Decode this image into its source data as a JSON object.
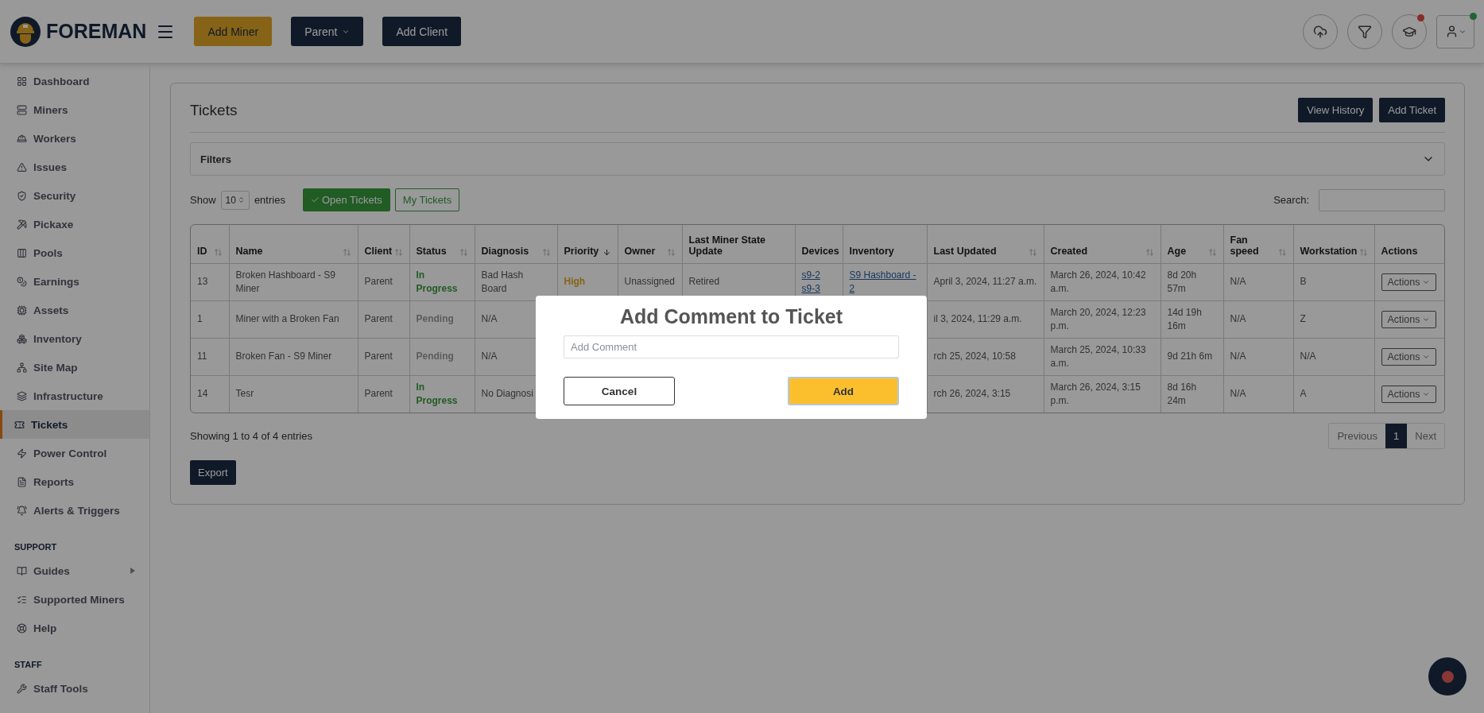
{
  "header": {
    "logo": "FOREMAN",
    "buttons": [
      {
        "label": "Add Miner",
        "kind": "gold"
      },
      {
        "label": "Parent",
        "kind": "dropdown"
      },
      {
        "label": "Add Client",
        "kind": "dark"
      }
    ],
    "notification_dot": true,
    "user_online": true
  },
  "sidebar": {
    "sections": [
      {
        "items": [
          {
            "label": "Dashboard",
            "selected": false
          },
          {
            "label": "Miners",
            "selected": false
          },
          {
            "label": "Workers",
            "selected": false
          },
          {
            "label": "Issues",
            "selected": false
          },
          {
            "label": "Security",
            "selected": false
          },
          {
            "label": "Pickaxe",
            "selected": false
          },
          {
            "label": "Pools",
            "selected": false
          },
          {
            "label": "Earnings",
            "selected": false
          },
          {
            "label": "Assets",
            "selected": false
          },
          {
            "label": "Inventory",
            "selected": false
          },
          {
            "label": "Site Map",
            "selected": false
          },
          {
            "label": "Infrastructure",
            "selected": false
          },
          {
            "label": "Tickets",
            "selected": true
          },
          {
            "label": "Power Control",
            "selected": false
          },
          {
            "label": "Reports",
            "selected": false
          },
          {
            "label": "Alerts & Triggers",
            "selected": false
          }
        ]
      },
      {
        "heading": "SUPPORT",
        "items": [
          {
            "label": "Guides",
            "selected": false,
            "submenu": true
          },
          {
            "label": "Supported Miners",
            "selected": false
          },
          {
            "label": "Help",
            "selected": false
          }
        ]
      },
      {
        "heading": "STAFF",
        "items": [
          {
            "label": "Staff Tools",
            "selected": false
          }
        ]
      }
    ]
  },
  "card": {
    "title": "Tickets",
    "buttons": [
      "View History",
      "Add Ticket"
    ],
    "filters": {
      "label": "Filters",
      "expanded": false
    },
    "length": {
      "before": "Show",
      "value": "10",
      "after": "entries"
    },
    "toggles": [
      {
        "label": "Open Tickets",
        "selected": true
      },
      {
        "label": "My Tickets",
        "selected": false
      }
    ],
    "search": {
      "label": "Search:"
    },
    "table": {
      "columns": [
        {
          "label": "ID",
          "sorted": false
        },
        {
          "label": "Name",
          "sorted": false
        },
        {
          "label": "Client",
          "sorted": false
        },
        {
          "label": "Status",
          "sorted": false
        },
        {
          "label": "Diagnosis",
          "sorted": false
        },
        {
          "label": "Priority",
          "sorted": true
        },
        {
          "label": "Owner",
          "sorted": false
        },
        {
          "label": "Last Miner State Update"
        },
        {
          "label": "Devices"
        },
        {
          "label": "Inventory"
        },
        {
          "label": "Last Updated",
          "sorted": false
        },
        {
          "label": "Created",
          "sorted": false
        },
        {
          "label": "Age",
          "sorted": false
        },
        {
          "label": "Fan speed",
          "sorted": false
        },
        {
          "label": "Workstation",
          "sorted": false
        },
        {
          "label": "Actions"
        }
      ],
      "rows": [
        {
          "id": "13",
          "name": "Broken Hashboard - S9 Miner",
          "client": "Parent",
          "status": {
            "text": "In Progress",
            "kind": "progress"
          },
          "diagnosis": "Bad Hash Board",
          "priority": {
            "text": "High",
            "kind": "high"
          },
          "owner": "Unassigned",
          "last_state": "Retired",
          "devices": [
            "s9-2",
            "s9-3"
          ],
          "inventory": [
            "S9 Hashboard - 2"
          ],
          "last_updated": "April 3, 2024, 11:27 a.m.",
          "created": "March 26, 2024, 10:42 a.m.",
          "age": "8d 20h 57m",
          "fan_speed": "N/A",
          "workstation": "B",
          "action": "Actions"
        },
        {
          "id": "1",
          "name": "Miner with a Broken Fan",
          "client": "Parent",
          "status": {
            "text": "Pending",
            "kind": "pending"
          },
          "diagnosis": "N/A",
          "last_updated": "il 3, 2024, 11:29 a.m.",
          "created": "March 20, 2024, 12:23 p.m.",
          "age": "14d 19h 16m",
          "fan_speed": "N/A",
          "workstation": "Z",
          "action": "Actions"
        },
        {
          "id": "11",
          "name": "Broken Fan - S9 Miner",
          "client": "Parent",
          "status": {
            "text": "Pending",
            "kind": "pending"
          },
          "diagnosis": "N/A",
          "last_updated": "rch 25, 2024, 10:58",
          "created": "March 25, 2024, 10:33 a.m.",
          "age": "9d 21h 6m",
          "fan_speed": "N/A",
          "workstation": "N/A",
          "action": "Actions"
        },
        {
          "id": "14",
          "name": "Tesr",
          "client": "Parent",
          "status": {
            "text": "In Progress",
            "kind": "progress"
          },
          "diagnosis": "No Diagnosi",
          "last_updated": "rch 26, 2024, 3:15",
          "created": "March 26, 2024, 3:15 p.m.",
          "age": "8d 16h 24m",
          "fan_speed": "N/A",
          "workstation": "A",
          "action": "Actions"
        }
      ]
    },
    "info": "Showing 1 to 4 of 4 entries",
    "pagination": [
      {
        "label": "Previous",
        "selected": false
      },
      {
        "label": "1",
        "selected": true
      },
      {
        "label": "Next",
        "selected": false
      }
    ],
    "export": "Export"
  },
  "modal": {
    "title": "Add Comment to Ticket",
    "placeholder": "Add Comment",
    "buttons": [
      {
        "label": "Cancel",
        "kind": "secondary"
      },
      {
        "label": "Add",
        "kind": "primary"
      }
    ]
  },
  "chat": {
    "unread": true
  }
}
